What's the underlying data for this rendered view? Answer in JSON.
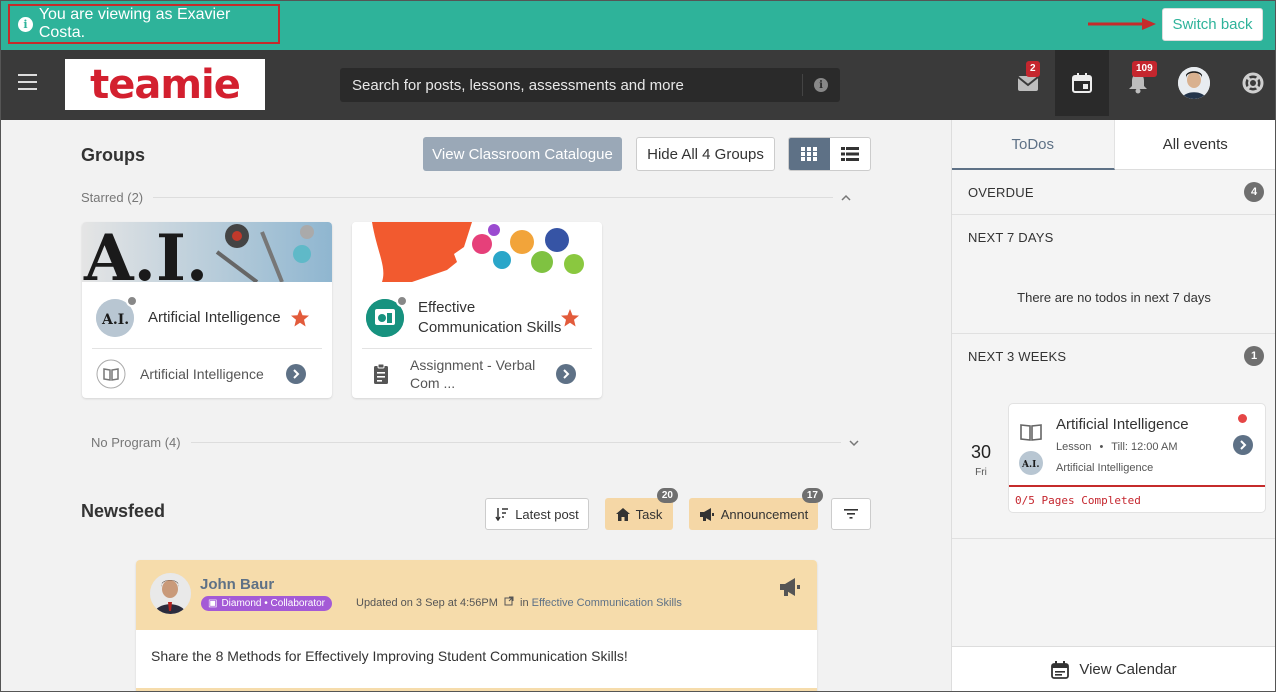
{
  "banner": {
    "impersonation_text": "You are viewing as Exavier Costa.",
    "switch_back_label": "Switch back",
    "bg_color": "#2eb39a",
    "highlight_color": "#c52b2b"
  },
  "topnav": {
    "logo_text": "teamie",
    "search_placeholder": "Search for posts, lessons, assessments and more",
    "messages_badge": "2",
    "notifications_badge": "109",
    "icons": [
      "menu-icon",
      "mail-icon",
      "calendar-icon",
      "bell-icon",
      "avatar",
      "help-icon"
    ]
  },
  "groups": {
    "heading": "Groups",
    "catalog_button": "View Classroom Catalogue",
    "hide_button": "Hide All 4 Groups",
    "starred_label": "Starred (2)",
    "no_program_label": "No Program (4)",
    "cards": [
      {
        "title": "Artificial Intelligence",
        "footer_text": "Artificial Intelligence",
        "footer_icon": "book-icon",
        "starred": true
      },
      {
        "title": "Effective Communication Skills",
        "footer_text": "Assignment - Verbal Com ...",
        "footer_icon": "clipboard-icon",
        "starred": true
      }
    ]
  },
  "newsfeed": {
    "heading": "Newsfeed",
    "sort_label": "Latest post",
    "task_label": "Task",
    "task_count": "20",
    "announcement_label": "Announcement",
    "announcement_count": "17",
    "post": {
      "author": "John Baur",
      "badge": "Diamond • Collaborator",
      "meta_updated": "Updated on 3 Sep at 4:56PM",
      "meta_in": "in",
      "meta_group": "Effective Communication Skills",
      "body": "Share the 8 Methods for Effectively Improving Student Communication Skills!"
    }
  },
  "right_panel": {
    "tab_todos": "ToDos",
    "tab_all_events": "All events",
    "overdue_label": "OVERDUE",
    "overdue_count": "4",
    "next7_label": "NEXT 7 DAYS",
    "next7_empty": "There are no todos in next 7 days",
    "next3w_label": "NEXT 3 WEEKS",
    "next3w_count": "1",
    "todo": {
      "day": "30",
      "weekday": "Fri",
      "title": "Artificial Intelligence",
      "type": "Lesson",
      "till": "Till: 12:00 AM",
      "group": "Artificial Intelligence",
      "progress": "0/5 Pages Completed"
    },
    "view_calendar_label": "View Calendar"
  }
}
